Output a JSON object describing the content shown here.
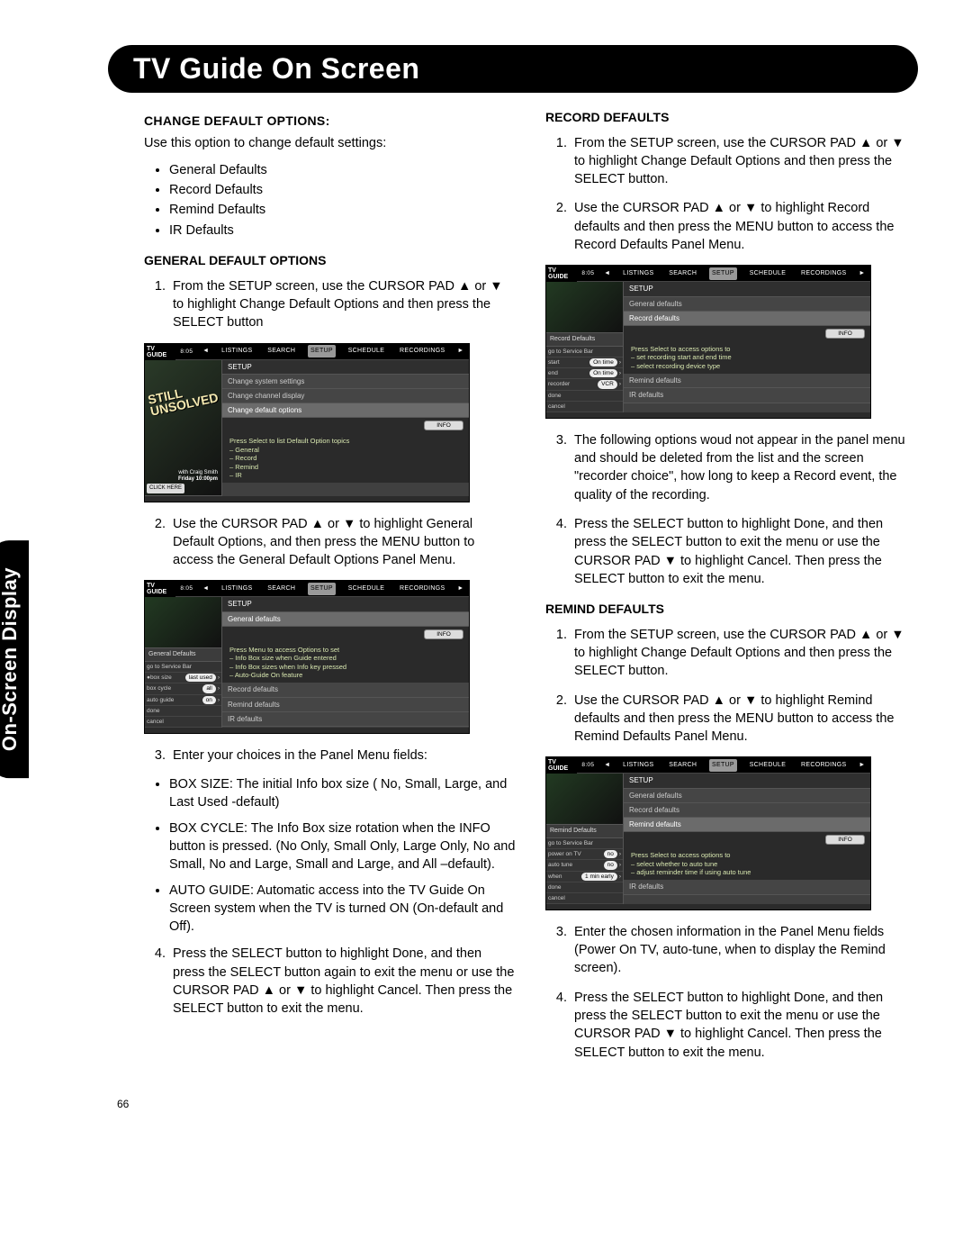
{
  "page_number": "66",
  "header_title": "TV Guide On Screen",
  "side_tab": "On-Screen Display",
  "arrows": {
    "up": "▲",
    "down": "▼"
  },
  "left": {
    "change_default": {
      "title": "CHANGE DEFAULT OPTIONS:",
      "intro": "Use this option to change default settings:",
      "bullets": [
        "General Defaults",
        "Record Defaults",
        "Remind Defaults",
        "IR Defaults"
      ]
    },
    "general_default": {
      "title": "GENERAL DEFAULT OPTIONS",
      "step1_a": "From the SETUP screen, use the CURSOR PAD ",
      "step1_b": " or ",
      "step1_c": " to highlight Change Default Options and then press the SELECT button",
      "step2_a": "Use the CURSOR PAD ",
      "step2_b": " or ",
      "step2_c": " to highlight General Default Options, and then press the MENU button to access the General Default Options Panel Menu.",
      "step3": "Enter your choices in the Panel Menu fields:",
      "field_bullets": [
        "BOX SIZE: The initial Info box size ( No, Small, Large, and Last Used -default)",
        "BOX CYCLE: The Info Box size rotation when the INFO button is pressed. (No Only, Small Only, Large Only, No and Small, No and Large, Small and Large, and All –default).",
        "AUTO GUIDE:  Automatic access into the TV Guide On Screen system when the TV is turned ON (On-default and Off)."
      ],
      "step4_a": "Press the SELECT button to highlight Done, and then press the SELECT button again to exit the menu or use the CURSOR PAD ",
      "step4_b": " or ",
      "step4_c": " to highlight Cancel. Then press the SELECT button to exit the menu."
    }
  },
  "right": {
    "record_defaults": {
      "title": "RECORD DEFAULTS",
      "step1_a": "From the SETUP screen, use the CURSOR PAD ",
      "step1_b": " or ",
      "step1_c": " to highlight Change Default Options and then press the SELECT button.",
      "step2_a": "Use the CURSOR PAD ",
      "step2_b": " or ",
      "step2_c": " to highlight Record defaults and then press the MENU button to access the Record Defaults Panel Menu.",
      "step3": "The following options woud not appear in the panel menu and should be deleted from the list and the screen \"recorder choice\", how long to keep a Record event, the quality of the recording.",
      "step4_a": "Press the SELECT button to highlight Done, and then press the SELECT button to exit the menu or use the CURSOR PAD ",
      "step4_b": " to highlight Cancel. Then press the SELECT button to exit the menu."
    },
    "remind_defaults": {
      "title": "REMIND DEFAULTS",
      "step1_a": "From the SETUP screen, use the CURSOR PAD ",
      "step1_b": " or ",
      "step1_c": " to highlight Change Default Options and then press the SELECT button.",
      "step2_a": "Use the CURSOR PAD ",
      "step2_b": " or ",
      "step2_c": " to highlight Remind defaults and then press the MENU button to access the Remind Defaults Panel Menu.",
      "step3": "Enter the chosen information in the Panel Menu fields (Power On TV, auto-tune, when to display the Remind screen).",
      "step4_a": "Press the SELECT button to highlight Done, and then press the SELECT button to exit the menu or use the CURSOR PAD ",
      "step4_b": " to highlight Cancel. Then press the SELECT button to exit the menu."
    }
  },
  "ss_common": {
    "logo": "TV GUIDE",
    "time": "8:05",
    "tabs": [
      "LISTINGS",
      "SEARCH",
      "SETUP",
      "SCHEDULE",
      "RECORDINGS"
    ],
    "info": "INFO"
  },
  "ss1": {
    "promo1": "STILL",
    "promo2": "UNSOLVED",
    "promo_sub1": "with Craig Smith",
    "promo_sub2": "Friday\n10:00pm",
    "click": "CLICK HERE",
    "rows_hdr": "SETUP",
    "rows": [
      "Change system settings",
      "Change channel display",
      "Change default options"
    ],
    "msg": "Press Select to list Default Option topics\n– General\n– Record\n– Remind\n– IR"
  },
  "ss2": {
    "panel_title": "General Defaults",
    "panel_rows": [
      {
        "l": "go to Service Bar",
        "v": ""
      },
      {
        "l": "box size",
        "v": "last used"
      },
      {
        "l": "box cycle",
        "v": "all"
      },
      {
        "l": "auto guide",
        "v": "on"
      },
      {
        "l": "done",
        "v": ""
      },
      {
        "l": "cancel",
        "v": ""
      }
    ],
    "rows_hdr": "SETUP",
    "rows": [
      "General defaults"
    ],
    "below": [
      "Record defaults",
      "Remind defaults",
      "IR defaults"
    ],
    "msg": "Press Menu to access Options to set\n– Info Box size when Guide entered\n– Info Box sizes when Info key pressed\n– Auto-Guide On feature"
  },
  "ss3": {
    "panel_title": "Record Defaults",
    "panel_rows": [
      {
        "l": "go to Service Bar",
        "v": ""
      },
      {
        "l": "start",
        "v": "On time"
      },
      {
        "l": "end",
        "v": "On time"
      },
      {
        "l": "recorder",
        "v": "VCR"
      },
      {
        "l": "done",
        "v": ""
      },
      {
        "l": "cancel",
        "v": ""
      }
    ],
    "rows_hdr": "SETUP",
    "rows": [
      "General defaults",
      "Record defaults"
    ],
    "below": [
      "Remind defaults",
      "IR defaults"
    ],
    "msg": "Press Select to access options to\n– set recording start and end time\n– select recording device type"
  },
  "ss4": {
    "panel_title": "Remind Defaults",
    "panel_rows": [
      {
        "l": "go to Service Bar",
        "v": ""
      },
      {
        "l": "power on TV",
        "v": "no"
      },
      {
        "l": "auto tune",
        "v": "no"
      },
      {
        "l": "when",
        "v": "1 min early"
      },
      {
        "l": "done",
        "v": ""
      },
      {
        "l": "cancel",
        "v": ""
      }
    ],
    "rows_hdr": "SETUP",
    "rows": [
      "General defaults",
      "Record defaults",
      "Remind defaults"
    ],
    "below": [
      "IR defaults"
    ],
    "msg": "Press Select to access options to\n– select whether to auto tune\n– adjust reminder time if using auto tune"
  }
}
